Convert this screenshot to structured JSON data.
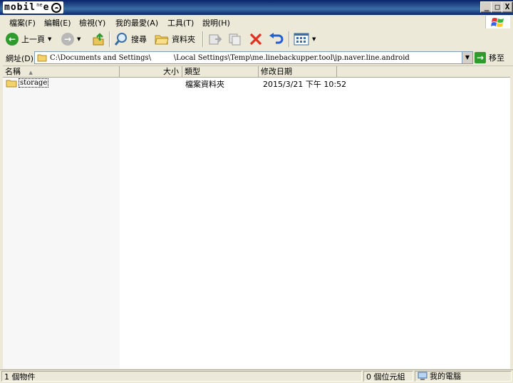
{
  "window": {
    "title_logo": "mobil",
    "title_logo_ne": "ne",
    "title_logo_tail": "e",
    "buttons": {
      "minimize": "_",
      "maximize": "□",
      "close": "X"
    }
  },
  "menubar": {
    "items": [
      {
        "label": "檔案(F)"
      },
      {
        "label": "編輯(E)"
      },
      {
        "label": "檢視(Y)"
      },
      {
        "label": "我的最愛(A)"
      },
      {
        "label": "工具(T)"
      },
      {
        "label": "說明(H)"
      }
    ]
  },
  "toolbar": {
    "back_label": "上一頁",
    "search_label": "搜尋",
    "folders_label": "資料夾"
  },
  "address": {
    "label": "網址(D)",
    "path": "C:\\Documents and Settings\\          \\Local Settings\\Temp\\me.linebackupper.tool\\jp.naver.line.android",
    "go_label": "移至"
  },
  "list": {
    "columns": {
      "name": "名稱",
      "size": "大小",
      "type": "類型",
      "modified": "修改日期"
    },
    "rows": [
      {
        "name": "storage",
        "size": "",
        "type": "檔案資料夾",
        "modified": "2015/3/21 下午 10:52"
      }
    ]
  },
  "status": {
    "objects": "1 個物件",
    "bytes": "0 個位元組",
    "location": "我的電腦"
  },
  "colors": {
    "titlebar": "#0a246a",
    "chrome": "#ece9d8",
    "back_green": "#2f9b2f",
    "delete_red": "#e03020",
    "undo_blue": "#2060d0"
  }
}
